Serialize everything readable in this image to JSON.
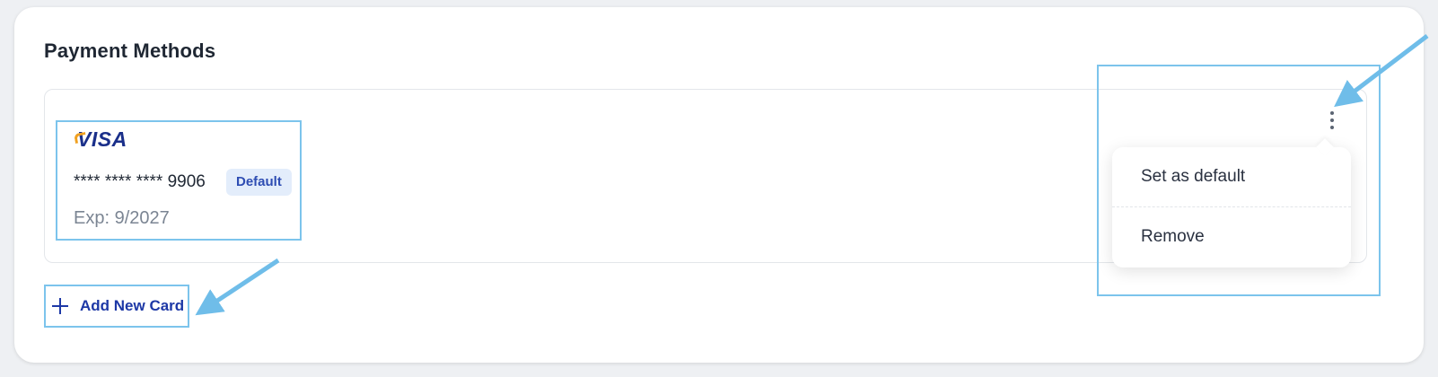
{
  "section": {
    "title": "Payment Methods"
  },
  "card": {
    "brand": "VISA",
    "number": "**** **** **** 9906",
    "badge": "Default",
    "expiry": "Exp: 9/2027"
  },
  "menu": {
    "items": [
      {
        "label": "Set as default"
      },
      {
        "label": "Remove"
      }
    ]
  },
  "actions": {
    "add_card_label": "Add New Card"
  },
  "colors": {
    "highlight": "#7cc4ec",
    "arrow": "#6fbde9",
    "primary_text": "#1d38a6",
    "badge_bg": "#e3edfb"
  },
  "icons": {
    "menu": "kebab-vertical-icon",
    "add": "plus-icon",
    "brand": "visa-logo"
  }
}
